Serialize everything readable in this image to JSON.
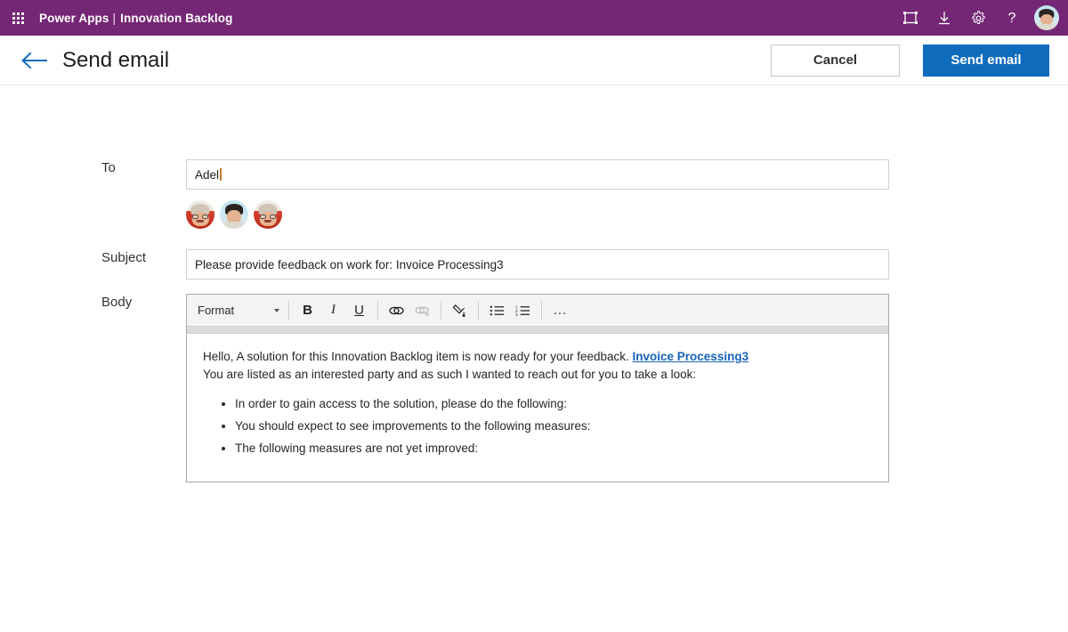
{
  "suite_bar": {
    "waffle_icon": "app-launcher-waffle-icon",
    "brand": "Power Apps",
    "separator": "|",
    "app_name": "Innovation Backlog",
    "icons": [
      {
        "name": "fit-to-screen-icon",
        "glyph": "fit-screen"
      },
      {
        "name": "download-icon",
        "glyph": "download-arrow"
      },
      {
        "name": "settings-gear-icon",
        "glyph": "gear"
      },
      {
        "name": "help-question-icon",
        "glyph": "question-mark"
      }
    ],
    "avatar_label": "user-avatar",
    "background_color": "#742774"
  },
  "command_bar": {
    "back_label": "back-arrow",
    "title": "Send email",
    "cancel_label": "Cancel",
    "send_label": "Send email",
    "send_color": "#0f6cbd",
    "back_arrow_color": "#0f6cbd"
  },
  "form": {
    "to": {
      "label": "To",
      "value": "Adel",
      "placeholder": ""
    },
    "people": [
      {
        "name": "person-avatar-1",
        "style": "pic-a"
      },
      {
        "name": "person-avatar-2",
        "style": "pic-b"
      },
      {
        "name": "person-avatar-3",
        "style": "pic-a"
      }
    ],
    "subject": {
      "label": "Subject",
      "value": "Please provide feedback on work for: Invoice Processing3",
      "placeholder": ""
    },
    "body": {
      "label": "Body",
      "toolbar": {
        "format_label": "Format",
        "bold": "B",
        "italic": "I",
        "underline": "U",
        "link_icon": "insert-link-icon",
        "unlink_icon": "remove-link-icon",
        "clear_format_icon": "clear-formatting-icon",
        "bullet_list_icon": "bulleted-list-icon",
        "numbered_list_icon": "numbered-list-icon",
        "overflow": "…"
      },
      "content": {
        "line1_before_link": "Hello, A solution for this Innovation Backlog item is now ready for your feedback. ",
        "link_text": "Invoice Processing3",
        "line2": "You are listed as an interested party and as such I wanted to reach out for you to take a look:",
        "bullets": [
          "In order to gain access to the solution, please do the following:",
          "You should expect to see improvements to the following measures:",
          "The following measures are not yet improved:"
        ]
      }
    }
  }
}
